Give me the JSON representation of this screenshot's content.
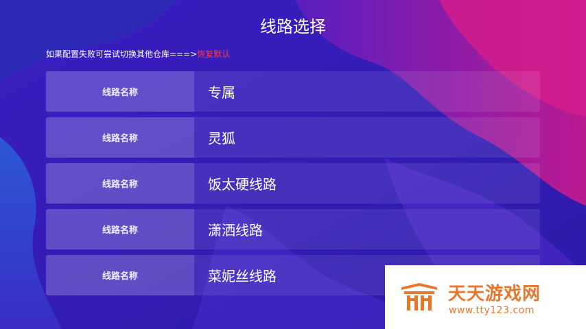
{
  "page": {
    "title": "线路选择",
    "hint_text": "如果配置失败可尝试切换其他仓库===>",
    "restore_link": "恢复默认"
  },
  "routes": [
    {
      "label": "线路名称",
      "name": "专属"
    },
    {
      "label": "线路名称",
      "name": "灵狐"
    },
    {
      "label": "线路名称",
      "name": "饭太硬线路"
    },
    {
      "label": "线路名称",
      "name": "潇洒线路"
    },
    {
      "label": "线路名称",
      "name": "菜妮丝线路"
    }
  ],
  "watermark": {
    "name": "天天游戏网",
    "url": "www.tty123.com"
  },
  "colors": {
    "background": "#3a1fb8",
    "accent_pink": "#d21c8c",
    "restore_link": "#ff3b3b",
    "watermark": "#e8772e"
  }
}
